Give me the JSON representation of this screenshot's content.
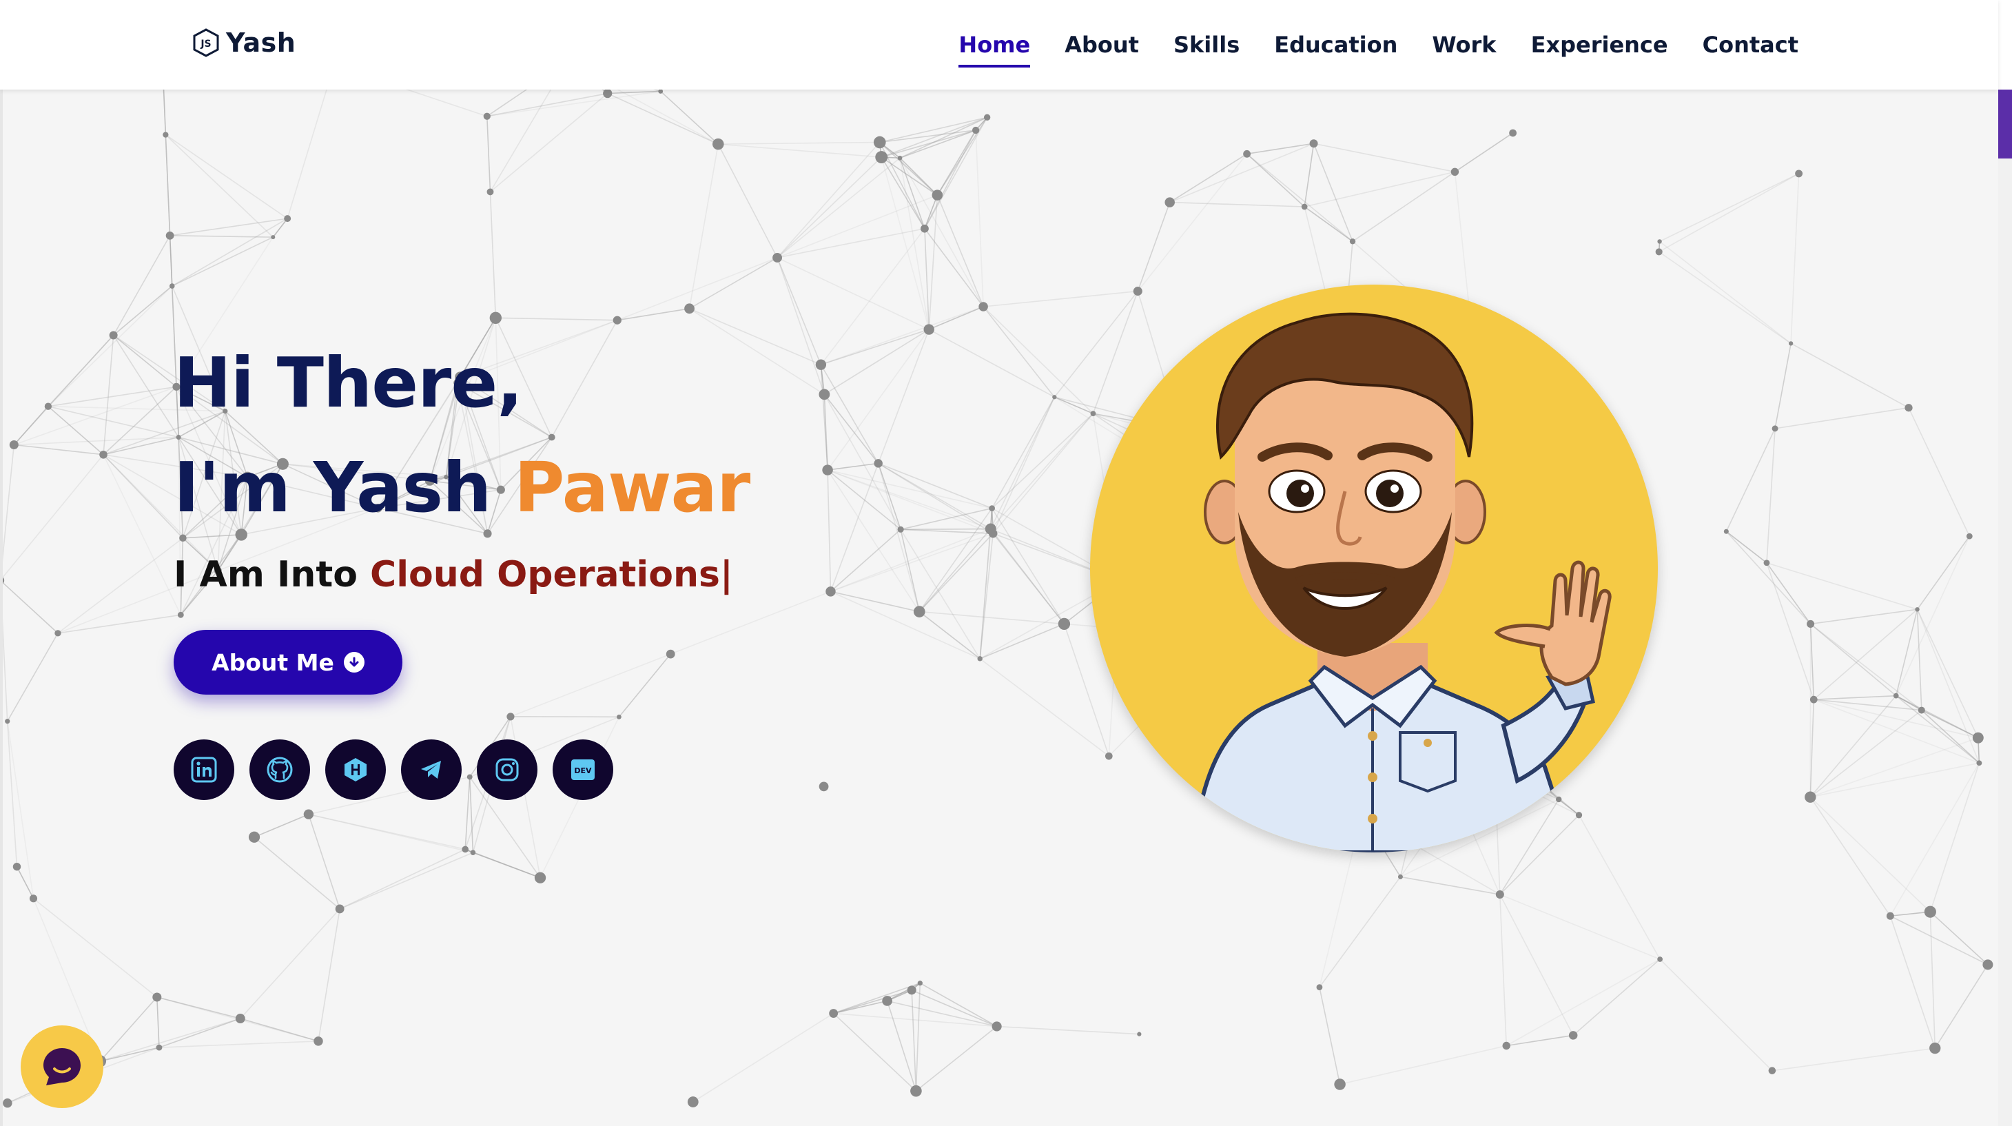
{
  "header": {
    "brand": "Yash",
    "brand_icon": "js-logo-icon",
    "nav": [
      {
        "label": "Home",
        "active": true
      },
      {
        "label": "About",
        "active": false
      },
      {
        "label": "Skills",
        "active": false
      },
      {
        "label": "Education",
        "active": false
      },
      {
        "label": "Work",
        "active": false
      },
      {
        "label": "Experience",
        "active": false
      },
      {
        "label": "Contact",
        "active": false
      }
    ]
  },
  "hero": {
    "line1": "Hi There,",
    "line2_prefix": "I'm Yash ",
    "line2_accent": "Pawar",
    "typing_prefix": "I Am Into ",
    "typing_role": "Cloud Operations",
    "typing_cursor": "|",
    "about_button": "About Me",
    "socials": [
      "linkedin-icon",
      "github-icon",
      "hashnode-icon",
      "telegram-icon",
      "instagram-icon",
      "dev-icon"
    ]
  },
  "colors": {
    "accent": "#2506ad",
    "name_accent": "#ef8a2f",
    "role": "#8a1a13",
    "heading": "#0e1a56",
    "avatar_bg": "#f5ca45"
  },
  "chat_icon": "chat-bubble-icon"
}
